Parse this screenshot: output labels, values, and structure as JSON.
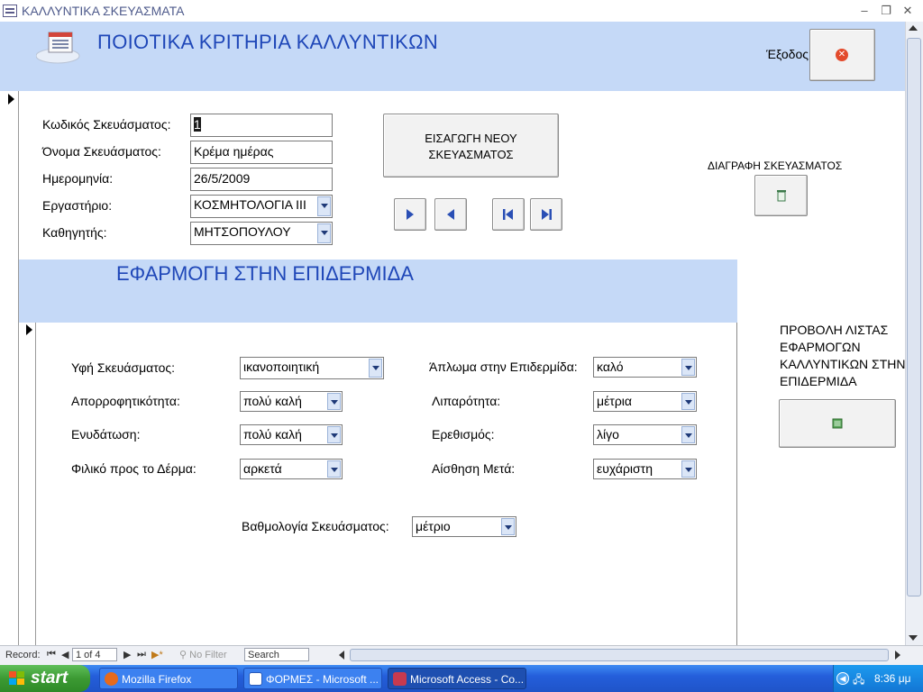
{
  "window": {
    "title": "ΚΑΛΛΥΝΤΙΚΑ ΣΚΕΥΑΣΜΑΤΑ",
    "minimize": "–",
    "restore": "❐",
    "close": "✕"
  },
  "header": {
    "title": "ΠΟΙΟΤΙΚΑ ΚΡΙΤΗΡΙΑ ΚΑΛΛΥΝΤΙΚΩΝ",
    "exit_label": "Έξοδος"
  },
  "main_form": {
    "code_label": "Κωδικός Σκευάσματος:",
    "code_value": "1",
    "name_label": "Όνομα Σκευάσματος:",
    "name_value": "Κρέμα ημέρας",
    "date_label": "Ημερομηνία:",
    "date_value": "26/5/2009",
    "lab_label": "Εργαστήριο:",
    "lab_value": "ΚΟΣΜΗΤΟΛΟΓΙΑ ΙΙΙ",
    "teacher_label": "Καθηγητής:",
    "teacher_value": "ΜΗΤΣΟΠΟΥΛΟΥ",
    "new_button_line1": "ΕΙΣΑΓΩΓΗ ΝΕΟΥ",
    "new_button_line2": "ΣΚΕΥΑΣΜΑΤΟΣ",
    "delete_label": "ΔΙΑΓΡΑΦΗ ΣΚΕΥΑΣΜΑΤΟΣ"
  },
  "subform": {
    "title": "ΕΦΑΡΜΟΓΗ  ΣΤΗΝ ΕΠΙΔΕΡΜΙΔΑ",
    "texture_label": "Υφή Σκευάσματος:",
    "texture_value": "ικανοποιητική",
    "absorb_label": "Απορροφητικότητα:",
    "absorb_value": "πολύ καλή",
    "hydration_label": "Ενυδάτωση:",
    "hydration_value": "πολύ καλή",
    "skin_friendly_label": "Φιλικό προς το Δέρμα:",
    "skin_friendly_value": "αρκετά",
    "spread_label": "Άπλωμα στην Επιδερμίδα:",
    "spread_value": "καλό",
    "oiliness_label": "Λιπαρότητα:",
    "oiliness_value": "μέτρια",
    "irritation_label": "Ερεθισμός:",
    "irritation_value": "λίγο",
    "after_feel_label": "Αίσθηση Μετά:",
    "after_feel_value": "ευχάριστη",
    "rating_label": "Βαθμολογία Σκευάσματος:",
    "rating_value": "μέτριο"
  },
  "side": {
    "list_line1": "ΠΡΟΒΟΛΗ ΛΙΣΤΑΣ",
    "list_line2": "ΕΦΑΡΜΟΓΩΝ",
    "list_line3": "ΚΑΛΛΥΝΤΙΚΩΝ ΣΤΗΝ",
    "list_line4": "ΕΠΙΔΕΡΜΙΔΑ"
  },
  "record_bar": {
    "label": "Record:",
    "position": "1 of 4",
    "filter": "No Filter",
    "search": "Search"
  },
  "taskbar": {
    "start": "start",
    "tasks": [
      "Mozilla Firefox",
      "ΦΟΡΜΕΣ - Microsoft ...",
      "Microsoft Access - Co..."
    ],
    "time": "8:36 μμ"
  },
  "colors": {
    "header_bg": "#c5d9f7",
    "title_blue": "#1f47b8",
    "taskbar_blue": "#245edb",
    "start_green": "#3c9a33"
  }
}
